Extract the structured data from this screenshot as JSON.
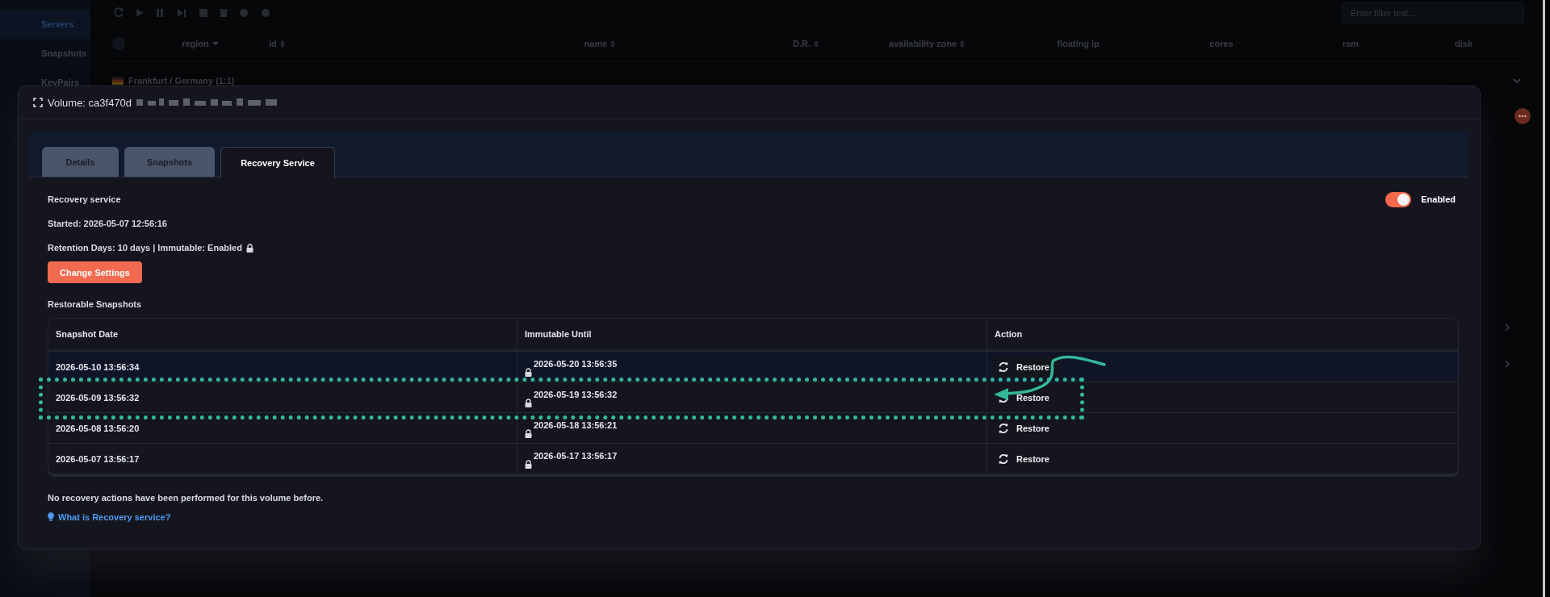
{
  "sidebar": {
    "items": [
      {
        "label": "Servers",
        "selected": true
      },
      {
        "label": "Snapshots",
        "selected": false
      },
      {
        "label": "KeyPairs",
        "selected": false
      }
    ]
  },
  "toolbar": {
    "filter": {
      "placeholder": "Enter filter text..."
    }
  },
  "servers_table": {
    "select_all": {
      "checked": false
    },
    "columns": [
      {
        "label": "region",
        "sortable": true,
        "sorted": true
      },
      {
        "label": "id",
        "sortable": true,
        "sorted": false
      },
      {
        "label": "name",
        "sortable": true,
        "sorted": false
      },
      {
        "label": "D.R.",
        "sortable": true,
        "sorted": false
      },
      {
        "label": "availability zone",
        "sortable": true,
        "sorted": false
      },
      {
        "label": "floating ip",
        "sortable": false,
        "sorted": false
      },
      {
        "label": "cores",
        "sortable": false,
        "sorted": false
      },
      {
        "label": "ram",
        "sortable": false,
        "sorted": false
      },
      {
        "label": "disk",
        "sortable": false,
        "sorted": false
      }
    ],
    "group": {
      "label": "Frankfurt / Germany (1:1)",
      "expanded": true
    }
  },
  "modal": {
    "title": "Volume: ca3f470d",
    "tabs": [
      {
        "label": "Details",
        "selected": false
      },
      {
        "label": "Snapshots",
        "selected": false
      },
      {
        "label": "Recovery Service",
        "selected": true
      }
    ],
    "section_title": "Recovery service",
    "service_toggle": {
      "on": true,
      "label": "Enabled"
    },
    "started": "Started: 2026-05-07 12:56:16",
    "retention": "Retention Days: 10 days | Immutable: Enabled",
    "change_button": "Change Settings",
    "snapshots_title": "Restorable Snapshots",
    "snapshots": {
      "columns": [
        "Snapshot Date",
        "Immutable Until",
        "Action"
      ],
      "rows": [
        {
          "date": "2026-05-10 13:56:34",
          "immutable_until": "2026-05-20 13:56:35",
          "action": "Restore",
          "hovered": true,
          "annotated": false
        },
        {
          "date": "2026-05-09 13:56:32",
          "immutable_until": "2026-05-19 13:56:32",
          "action": "Restore",
          "hovered": false,
          "annotated": true
        },
        {
          "date": "2026-05-08 13:56:20",
          "immutable_until": "2026-05-18 13:56:21",
          "action": "Restore",
          "hovered": false,
          "annotated": false
        },
        {
          "date": "2026-05-07 13:56:17",
          "immutable_until": "2026-05-17 13:56:17",
          "action": "Restore",
          "hovered": false,
          "annotated": false
        }
      ]
    },
    "message": "No recovery actions have been performed for this volume before.",
    "help_link": "What is Recovery service?"
  }
}
